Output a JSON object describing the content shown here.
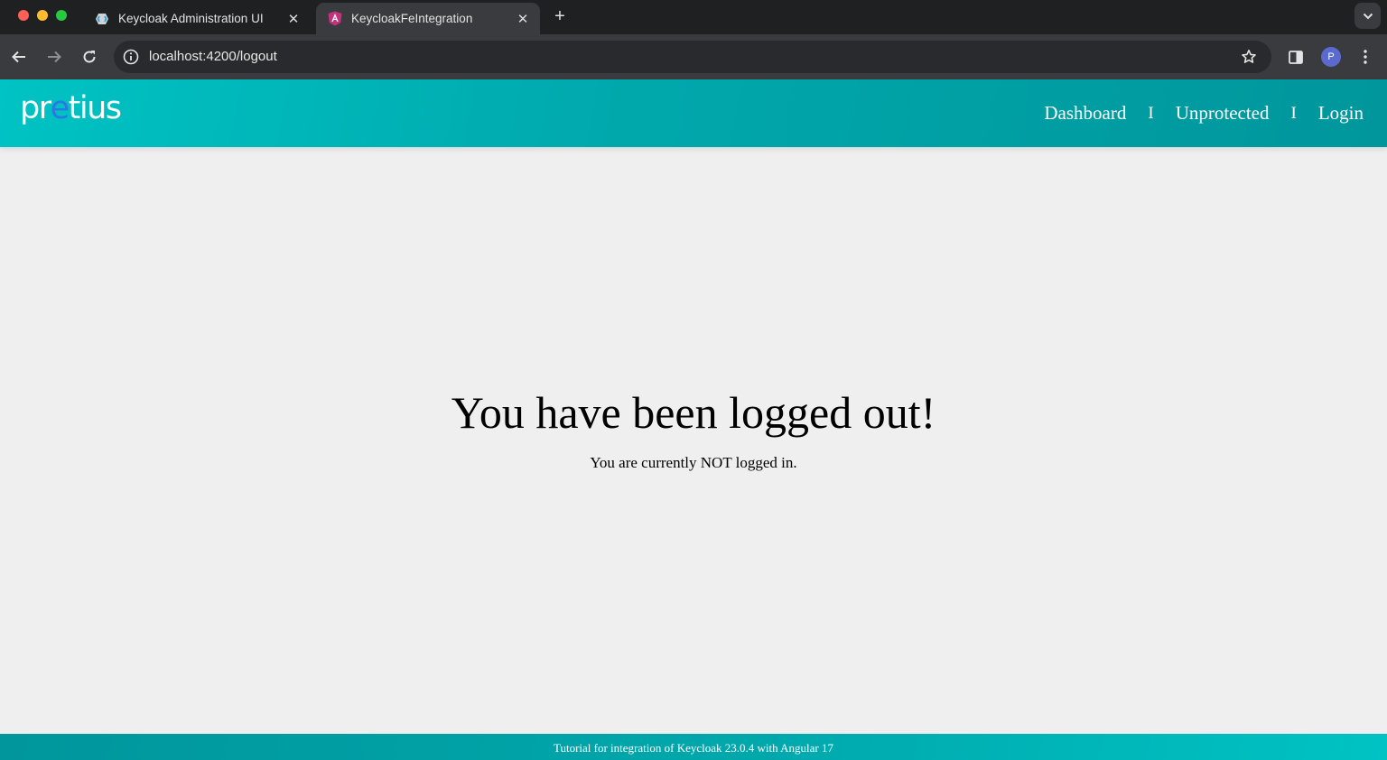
{
  "browser": {
    "tabs": [
      {
        "title": "Keycloak Administration UI",
        "favicon": "keycloak-icon",
        "active": false
      },
      {
        "title": "KeycloakFeIntegration",
        "favicon": "angular-icon",
        "active": true
      }
    ],
    "address_bar": {
      "url": "localhost:4200/logout"
    },
    "profile_initial": "P"
  },
  "header": {
    "logo": {
      "part1": "pr",
      "accent": "e",
      "part2": "tius"
    },
    "nav": {
      "dashboard": "Dashboard",
      "unprotected": "Unprotected",
      "login": "Login",
      "separator": "I"
    }
  },
  "main": {
    "title": "You have been logged out!",
    "subtitle": "You are currently NOT logged in."
  },
  "footer": {
    "text": "Tutorial for integration of Keycloak 23.0.4 with Angular 17"
  },
  "colors": {
    "header_teal": "#00a8ac",
    "logo_accent": "#2a78e4",
    "page_bg": "#efefef"
  }
}
